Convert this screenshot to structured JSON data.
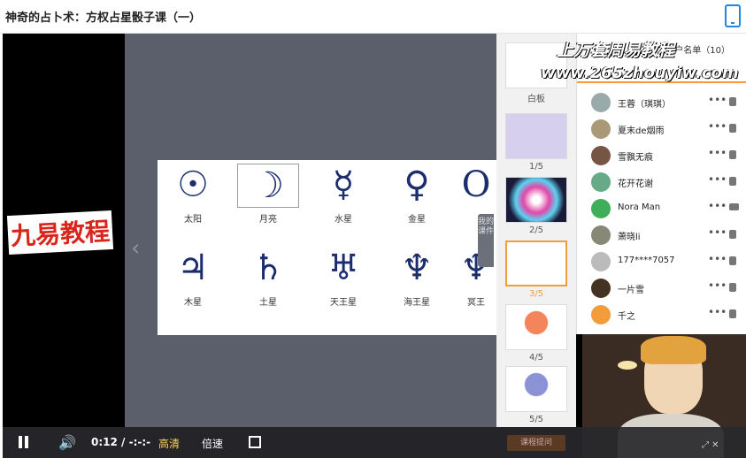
{
  "header": {
    "title": "神奇的占卜术：方权占星骰子课（一）"
  },
  "board": {
    "symbols": [
      {
        "glyph": "☉",
        "name": "太阳"
      },
      {
        "glyph": "☽",
        "name": "月亮"
      },
      {
        "glyph": "☿",
        "name": "水星"
      },
      {
        "glyph": "♀",
        "name": "金星"
      },
      {
        "glyph": "O",
        "name": ""
      },
      {
        "glyph": "♃",
        "name": "木星"
      },
      {
        "glyph": "♄",
        "name": "土星"
      },
      {
        "glyph": "♅",
        "name": "天王星"
      },
      {
        "glyph": "♆",
        "name": "海王星"
      },
      {
        "glyph": "♆",
        "name": "冥王"
      }
    ]
  },
  "drawer": {
    "label": "我的课件"
  },
  "thumbnails": [
    {
      "label": "白板"
    },
    {
      "label": "1/5"
    },
    {
      "label": "2/5"
    },
    {
      "label": "3/5"
    },
    {
      "label": "4/5"
    },
    {
      "label": "5/5"
    }
  ],
  "members": {
    "heading": "户名单（10）",
    "list": [
      {
        "name": "王蓉（琪琪）"
      },
      {
        "name": "夏末de烟雨"
      },
      {
        "name": "雪飘无痕"
      },
      {
        "name": "花开花谢"
      },
      {
        "name": "Nora Man"
      },
      {
        "name": "萧晓li"
      },
      {
        "name": "177****7057"
      },
      {
        "name": "一片雪"
      },
      {
        "name": "千之"
      }
    ],
    "dots": "•••"
  },
  "watermarks": {
    "top": "上万套周易教程",
    "url": "www.265zhouyiw.com",
    "left": "九易教程"
  },
  "controls": {
    "time": "0:12 / -:-:-",
    "hd": "高清",
    "speed": "倍速",
    "hang": "课程提问"
  }
}
